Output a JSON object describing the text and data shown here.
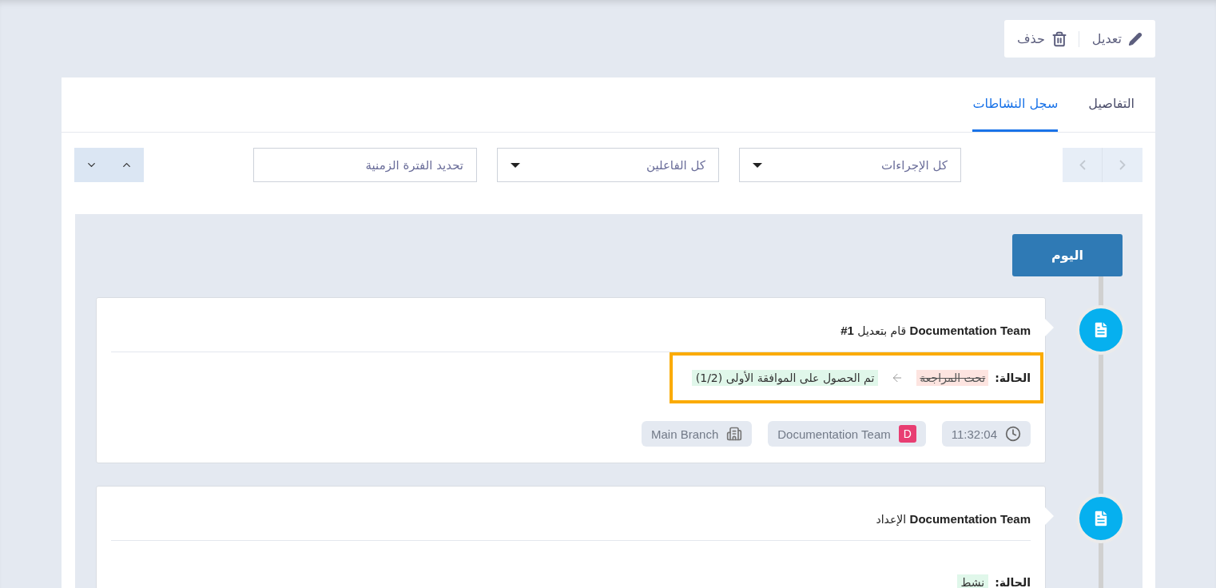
{
  "actions": [
    {
      "kind": "edit",
      "label": "تعديل"
    },
    {
      "kind": "delete",
      "label": "حذف"
    }
  ],
  "tabs": [
    {
      "label": "التفاصيل",
      "selected": false
    },
    {
      "label": "سجل النشاطات",
      "selected": true
    }
  ],
  "filters": {
    "actions": "كل الإجراءات",
    "actors": "كل الفاعلين",
    "date_range": {
      "placeholder": "تحديد الفترة الزمنية"
    }
  },
  "timeline": {
    "day_label": "اليوم",
    "entries": [
      {
        "title": "**Documentation Team** قام بتعديل **#1**",
        "status": {
          "label": "الحالة:",
          "kind": "change",
          "old_value": "تحت المراجعة",
          "new_value": "تم الحصول على الموافقة الأولى (1/2)",
          "highlighted": true
        },
        "time": "11:32:04",
        "user": {
          "initial": "D",
          "name": "Documentation Team"
        },
        "branch": "Main Branch"
      },
      {
        "title": "**Documentation Team** الإعداد",
        "status": {
          "label": "الحالة:",
          "kind": "value",
          "new_value": "نشط",
          "highlighted": false
        }
      }
    ]
  }
}
